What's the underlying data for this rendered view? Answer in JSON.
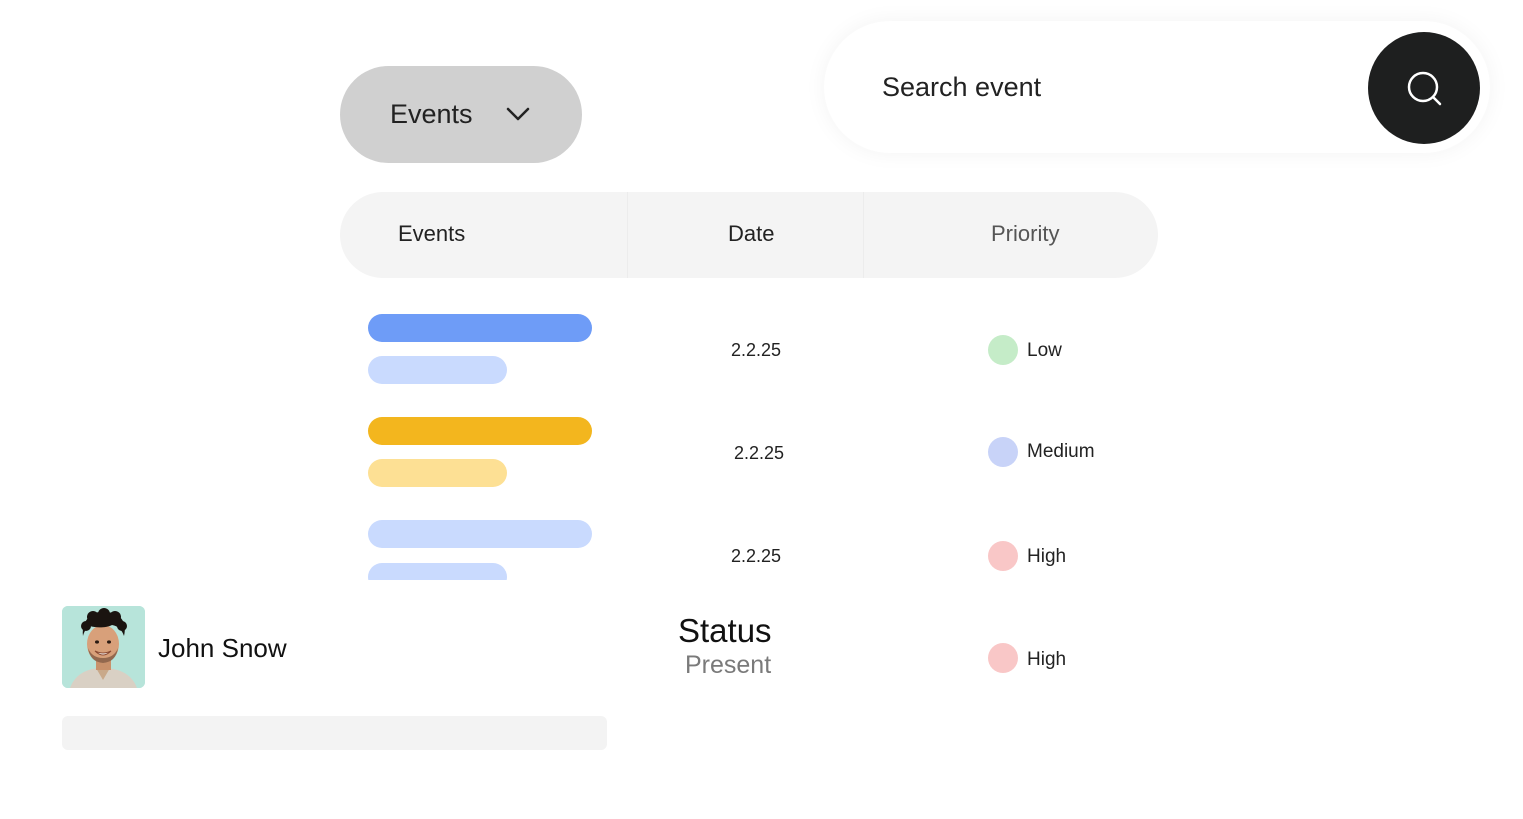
{
  "dropdown": {
    "label": "Events",
    "icon": "chevron-down-icon"
  },
  "search": {
    "placeholder": "Search event",
    "icon": "search-icon"
  },
  "table": {
    "headers": [
      "Events",
      "Date",
      "Priority"
    ],
    "rows": [
      {
        "date": "2.2.25",
        "priority": "Low",
        "priority_color": "#c5ecc8",
        "bar_primary": "#6e9cf7",
        "bar_secondary": "#c9dafe"
      },
      {
        "date": "2.2.25",
        "priority": "Medium",
        "priority_color": "#c8d3f8",
        "bar_primary": "#f3b61e",
        "bar_secondary": "#fde094"
      },
      {
        "date": "2.2.25",
        "priority": "High",
        "priority_color": "#f9c7c7",
        "bar_primary": "#c9dafe",
        "bar_secondary": "#c9dafe"
      }
    ]
  },
  "profile": {
    "name": "John Snow",
    "status_label": "Status",
    "status_value": "Present",
    "priority": "High",
    "priority_color": "#f9c7c7",
    "avatar_bg": "#b7e4da"
  },
  "colors": {
    "dropdown_bg": "#d0d0d0",
    "search_button_bg": "#1e1f1f",
    "header_bg": "#f4f4f4"
  }
}
